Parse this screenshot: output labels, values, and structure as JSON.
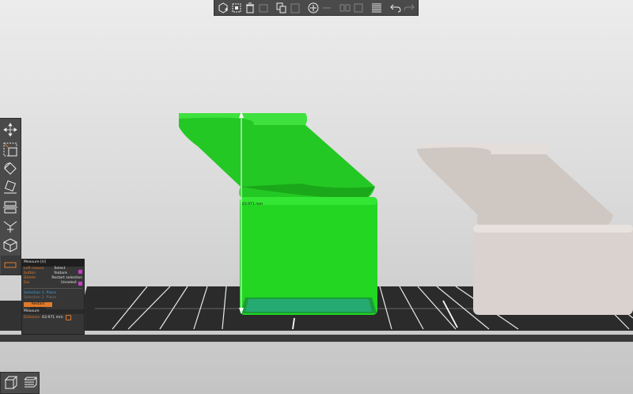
{
  "toolbar_top": {
    "buttons": [
      {
        "name": "add-icon",
        "enabled": true
      },
      {
        "name": "arrange-icon",
        "enabled": true
      },
      {
        "name": "delete-icon",
        "enabled": true
      },
      {
        "name": "delete-all-icon",
        "enabled": false
      },
      {
        "name": "copy-icon",
        "enabled": true
      },
      {
        "name": "paste-icon",
        "enabled": false
      },
      {
        "name": "add-instance-icon",
        "enabled": true
      },
      {
        "name": "remove-instance-icon",
        "enabled": false
      },
      {
        "name": "split-objects-icon",
        "enabled": false
      },
      {
        "name": "split-parts-icon",
        "enabled": false
      },
      {
        "name": "layers-editing-icon",
        "enabled": true
      },
      {
        "name": "undo-icon",
        "enabled": true
      },
      {
        "name": "redo-icon",
        "enabled": false
      }
    ]
  },
  "toolbar_left": {
    "tools": [
      "move-icon",
      "scale-icon",
      "rotate-icon",
      "place-on-face-icon",
      "cut-icon",
      "support-painting-icon",
      "seam-painting-icon",
      "measure-icon"
    ],
    "active": "measure-icon"
  },
  "measure_panel": {
    "title": "Measure [U]",
    "rows": [
      {
        "key": "Left mouse button",
        "value": "Select feature",
        "swatch": true
      },
      {
        "key": "Delete",
        "value": "Restart selection",
        "swatch": false
      },
      {
        "key": "Esc",
        "value": "Unselect",
        "swatch": true
      }
    ],
    "selection_1": "Selection 1: Plane",
    "selection_2": "Selection 2: Plane",
    "restart_label": "Restart selection",
    "measure_header": "Measure",
    "distance_label": "Distance",
    "distance_value": "63.971 mm"
  },
  "scene": {
    "measurement_label": "63.971 mm",
    "colors": {
      "selected_object": "#1fd21f",
      "other_object": "#d6cfca",
      "bed": "#2d2d2d",
      "accent": "#e07a2a"
    }
  },
  "view_buttons": [
    "3d-view-icon",
    "preview-icon"
  ]
}
